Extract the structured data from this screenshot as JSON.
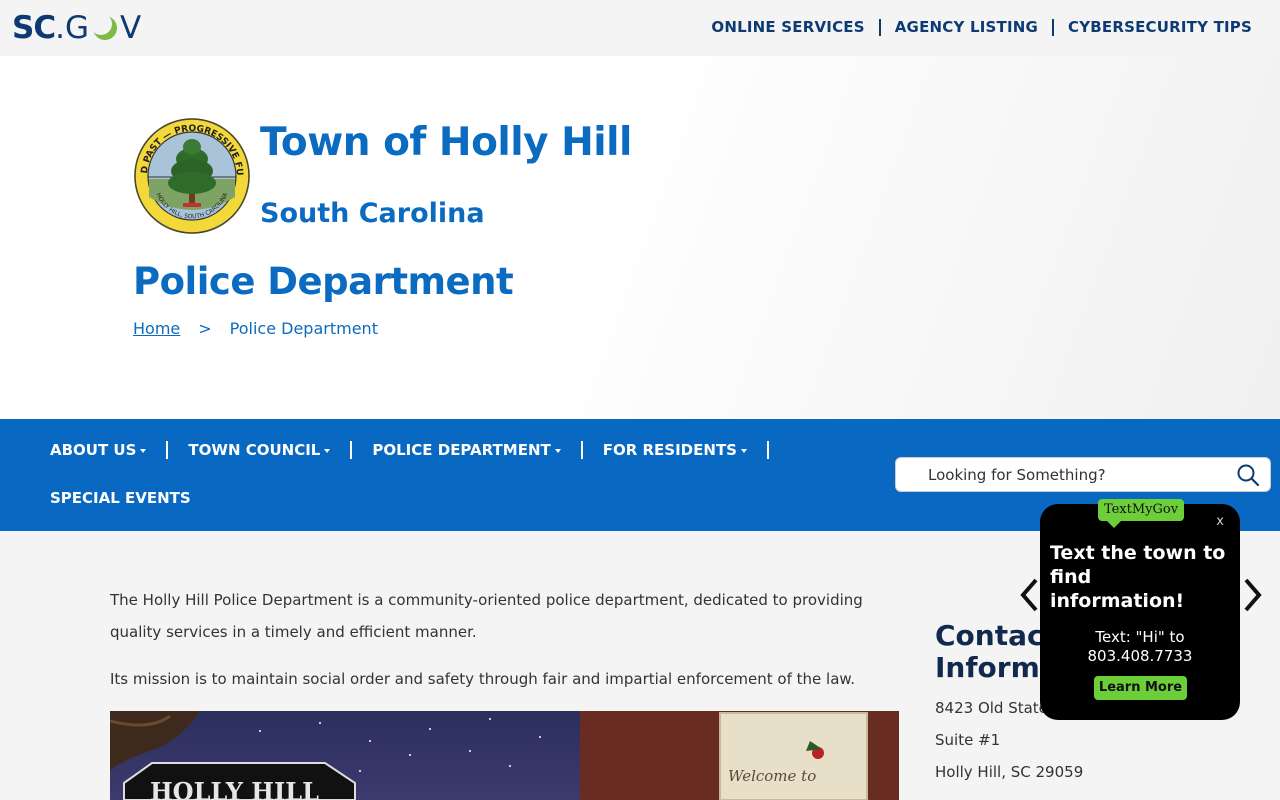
{
  "topbar": {
    "logo": {
      "sc": "SC",
      "dot": ".",
      "g": "G",
      "v": "V"
    },
    "links": [
      {
        "label": "ONLINE SERVICES"
      },
      {
        "label": "AGENCY LISTING"
      },
      {
        "label": "CYBERSECURITY TIPS"
      }
    ]
  },
  "hero": {
    "town_title": "Town of Holly Hill",
    "state_title": "South Carolina",
    "page_title": "Police Department",
    "seal": {
      "top_text": "PROUD PAST — PROGRESSIVE FUTURE",
      "bottom_text": "HOLLY HILL, SOUTH CAROLINA"
    },
    "breadcrumb": {
      "home": "Home",
      "separator": ">",
      "current": "Police Department"
    }
  },
  "mainnav": {
    "row1": [
      {
        "label": "ABOUT US"
      },
      {
        "label": "TOWN COUNCIL"
      },
      {
        "label": "POLICE DEPARTMENT"
      },
      {
        "label": "FOR RESIDENTS"
      }
    ],
    "row2": [
      {
        "label": "SPECIAL EVENTS"
      }
    ],
    "search": {
      "placeholder": "Looking for Something?"
    }
  },
  "content": {
    "intro": "The Holly Hill Police Department is a community-oriented police department, dedicated to providing quality services in a timely and efficient manner.",
    "mission": "Its mission is to maintain social order and safety through fair and impartial enforcement of the law.",
    "photo": {
      "sign_text": "HOLLY HILL",
      "welcome_text": "Welcome to"
    }
  },
  "contact": {
    "heading_line1": "Contact",
    "heading_line2": "Information",
    "address1": "8423 Old State Road",
    "address2": "Suite #1",
    "address3": "Holly Hill, SC  29059"
  },
  "widget": {
    "brand": "TextMyGov",
    "close": "x",
    "headline": "Text the town to find information!",
    "text_line1": "Text: \"Hi\" to",
    "text_line2": "803.408.7733",
    "button": "Learn More"
  },
  "colors": {
    "brand_blue": "#0b6bc0",
    "nav_blue": "#0868c2",
    "navy": "#0d3a73",
    "widget_green": "#6ccf3a"
  }
}
